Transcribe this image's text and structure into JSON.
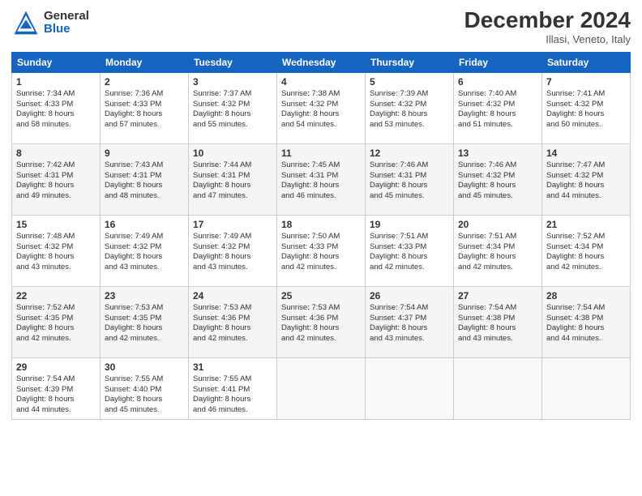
{
  "header": {
    "logo_general": "General",
    "logo_blue": "Blue",
    "month_title": "December 2024",
    "location": "Illasi, Veneto, Italy"
  },
  "weekdays": [
    "Sunday",
    "Monday",
    "Tuesday",
    "Wednesday",
    "Thursday",
    "Friday",
    "Saturday"
  ],
  "weeks": [
    [
      {
        "day": "1",
        "lines": [
          "Sunrise: 7:34 AM",
          "Sunset: 4:33 PM",
          "Daylight: 8 hours",
          "and 58 minutes."
        ]
      },
      {
        "day": "2",
        "lines": [
          "Sunrise: 7:36 AM",
          "Sunset: 4:33 PM",
          "Daylight: 8 hours",
          "and 57 minutes."
        ]
      },
      {
        "day": "3",
        "lines": [
          "Sunrise: 7:37 AM",
          "Sunset: 4:32 PM",
          "Daylight: 8 hours",
          "and 55 minutes."
        ]
      },
      {
        "day": "4",
        "lines": [
          "Sunrise: 7:38 AM",
          "Sunset: 4:32 PM",
          "Daylight: 8 hours",
          "and 54 minutes."
        ]
      },
      {
        "day": "5",
        "lines": [
          "Sunrise: 7:39 AM",
          "Sunset: 4:32 PM",
          "Daylight: 8 hours",
          "and 53 minutes."
        ]
      },
      {
        "day": "6",
        "lines": [
          "Sunrise: 7:40 AM",
          "Sunset: 4:32 PM",
          "Daylight: 8 hours",
          "and 51 minutes."
        ]
      },
      {
        "day": "7",
        "lines": [
          "Sunrise: 7:41 AM",
          "Sunset: 4:32 PM",
          "Daylight: 8 hours",
          "and 50 minutes."
        ]
      }
    ],
    [
      {
        "day": "8",
        "lines": [
          "Sunrise: 7:42 AM",
          "Sunset: 4:31 PM",
          "Daylight: 8 hours",
          "and 49 minutes."
        ]
      },
      {
        "day": "9",
        "lines": [
          "Sunrise: 7:43 AM",
          "Sunset: 4:31 PM",
          "Daylight: 8 hours",
          "and 48 minutes."
        ]
      },
      {
        "day": "10",
        "lines": [
          "Sunrise: 7:44 AM",
          "Sunset: 4:31 PM",
          "Daylight: 8 hours",
          "and 47 minutes."
        ]
      },
      {
        "day": "11",
        "lines": [
          "Sunrise: 7:45 AM",
          "Sunset: 4:31 PM",
          "Daylight: 8 hours",
          "and 46 minutes."
        ]
      },
      {
        "day": "12",
        "lines": [
          "Sunrise: 7:46 AM",
          "Sunset: 4:31 PM",
          "Daylight: 8 hours",
          "and 45 minutes."
        ]
      },
      {
        "day": "13",
        "lines": [
          "Sunrise: 7:46 AM",
          "Sunset: 4:32 PM",
          "Daylight: 8 hours",
          "and 45 minutes."
        ]
      },
      {
        "day": "14",
        "lines": [
          "Sunrise: 7:47 AM",
          "Sunset: 4:32 PM",
          "Daylight: 8 hours",
          "and 44 minutes."
        ]
      }
    ],
    [
      {
        "day": "15",
        "lines": [
          "Sunrise: 7:48 AM",
          "Sunset: 4:32 PM",
          "Daylight: 8 hours",
          "and 43 minutes."
        ]
      },
      {
        "day": "16",
        "lines": [
          "Sunrise: 7:49 AM",
          "Sunset: 4:32 PM",
          "Daylight: 8 hours",
          "and 43 minutes."
        ]
      },
      {
        "day": "17",
        "lines": [
          "Sunrise: 7:49 AM",
          "Sunset: 4:32 PM",
          "Daylight: 8 hours",
          "and 43 minutes."
        ]
      },
      {
        "day": "18",
        "lines": [
          "Sunrise: 7:50 AM",
          "Sunset: 4:33 PM",
          "Daylight: 8 hours",
          "and 42 minutes."
        ]
      },
      {
        "day": "19",
        "lines": [
          "Sunrise: 7:51 AM",
          "Sunset: 4:33 PM",
          "Daylight: 8 hours",
          "and 42 minutes."
        ]
      },
      {
        "day": "20",
        "lines": [
          "Sunrise: 7:51 AM",
          "Sunset: 4:34 PM",
          "Daylight: 8 hours",
          "and 42 minutes."
        ]
      },
      {
        "day": "21",
        "lines": [
          "Sunrise: 7:52 AM",
          "Sunset: 4:34 PM",
          "Daylight: 8 hours",
          "and 42 minutes."
        ]
      }
    ],
    [
      {
        "day": "22",
        "lines": [
          "Sunrise: 7:52 AM",
          "Sunset: 4:35 PM",
          "Daylight: 8 hours",
          "and 42 minutes."
        ]
      },
      {
        "day": "23",
        "lines": [
          "Sunrise: 7:53 AM",
          "Sunset: 4:35 PM",
          "Daylight: 8 hours",
          "and 42 minutes."
        ]
      },
      {
        "day": "24",
        "lines": [
          "Sunrise: 7:53 AM",
          "Sunset: 4:36 PM",
          "Daylight: 8 hours",
          "and 42 minutes."
        ]
      },
      {
        "day": "25",
        "lines": [
          "Sunrise: 7:53 AM",
          "Sunset: 4:36 PM",
          "Daylight: 8 hours",
          "and 42 minutes."
        ]
      },
      {
        "day": "26",
        "lines": [
          "Sunrise: 7:54 AM",
          "Sunset: 4:37 PM",
          "Daylight: 8 hours",
          "and 43 minutes."
        ]
      },
      {
        "day": "27",
        "lines": [
          "Sunrise: 7:54 AM",
          "Sunset: 4:38 PM",
          "Daylight: 8 hours",
          "and 43 minutes."
        ]
      },
      {
        "day": "28",
        "lines": [
          "Sunrise: 7:54 AM",
          "Sunset: 4:38 PM",
          "Daylight: 8 hours",
          "and 44 minutes."
        ]
      }
    ],
    [
      {
        "day": "29",
        "lines": [
          "Sunrise: 7:54 AM",
          "Sunset: 4:39 PM",
          "Daylight: 8 hours",
          "and 44 minutes."
        ]
      },
      {
        "day": "30",
        "lines": [
          "Sunrise: 7:55 AM",
          "Sunset: 4:40 PM",
          "Daylight: 8 hours",
          "and 45 minutes."
        ]
      },
      {
        "day": "31",
        "lines": [
          "Sunrise: 7:55 AM",
          "Sunset: 4:41 PM",
          "Daylight: 8 hours",
          "and 46 minutes."
        ]
      },
      null,
      null,
      null,
      null
    ]
  ]
}
